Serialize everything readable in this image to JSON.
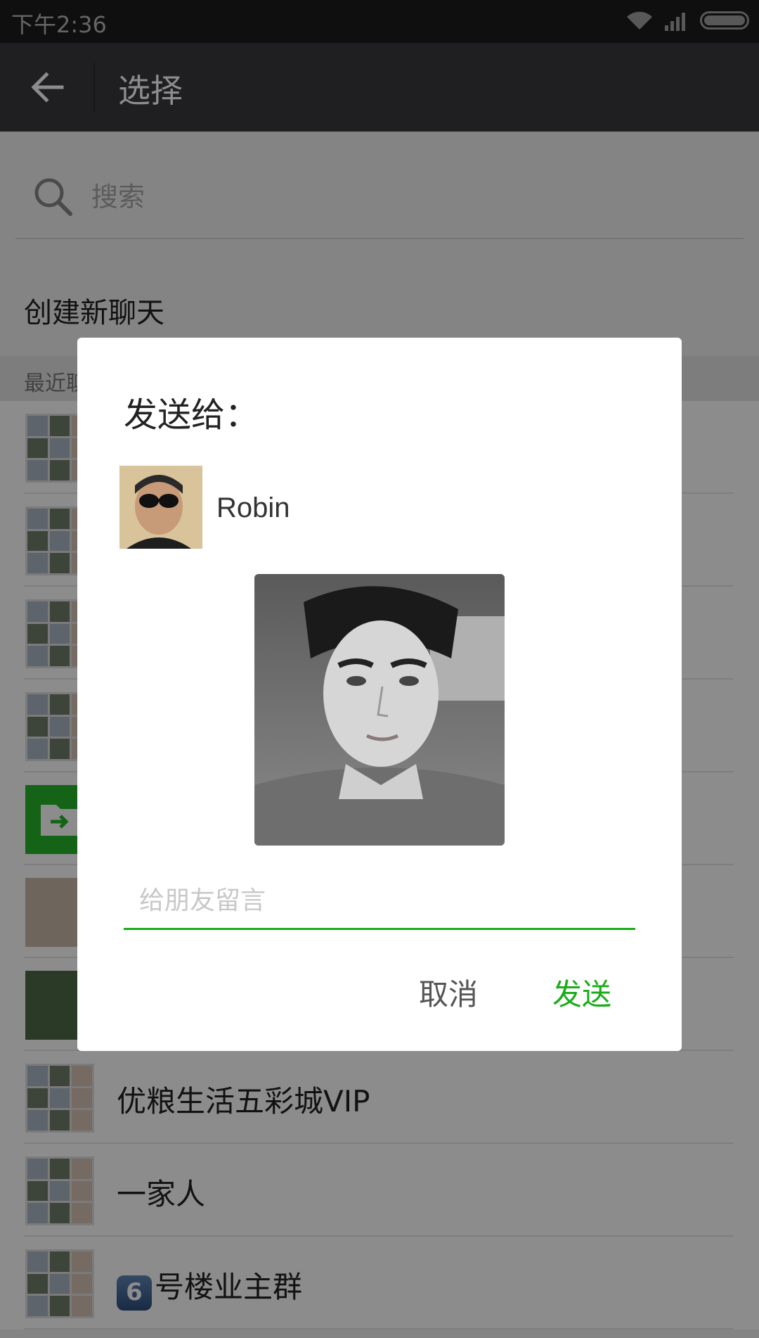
{
  "status_bar": {
    "time": "下午2:36"
  },
  "app_bar": {
    "title": "选择"
  },
  "search": {
    "placeholder": "搜索"
  },
  "new_chat": {
    "label": "创建新聊天"
  },
  "recent": {
    "section_label": "最近聊"
  },
  "chats": [
    {
      "name": "",
      "avatar": "group-grid"
    },
    {
      "name": "",
      "avatar": "group-grid"
    },
    {
      "name": "",
      "avatar": "group-grid"
    },
    {
      "name": "",
      "avatar": "group-grid"
    },
    {
      "name": "",
      "avatar": "file-transfer-icon"
    },
    {
      "name": "",
      "avatar": "photo"
    },
    {
      "name": "",
      "avatar": "photo"
    },
    {
      "name": "优粮生活五彩城VIP",
      "avatar": "group-grid"
    },
    {
      "name": "一家人",
      "avatar": "group-grid"
    },
    {
      "name": "号楼业主群",
      "badge": "6",
      "avatar": "group-grid"
    }
  ],
  "dialog": {
    "title": "发送给：",
    "recipient_name": "Robin",
    "message_placeholder": "给朋友留言",
    "cancel_label": "取消",
    "send_label": "发送",
    "accent_color": "#1aad19"
  }
}
